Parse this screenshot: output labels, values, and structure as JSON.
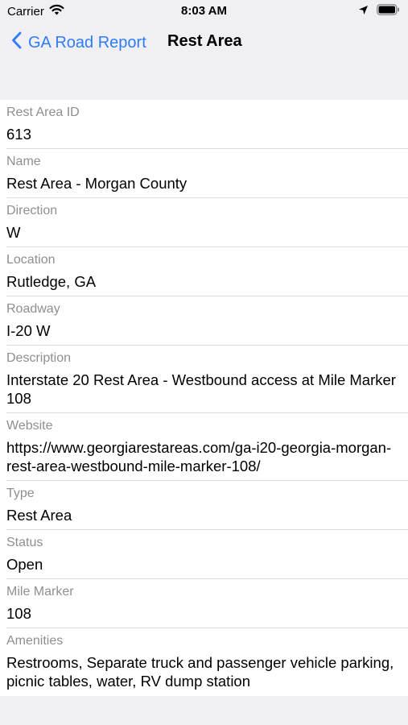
{
  "status_bar": {
    "carrier": "Carrier",
    "time": "8:03 AM"
  },
  "nav": {
    "back_label": "GA Road Report",
    "title": "Rest Area"
  },
  "fields": [
    {
      "label": "Rest Area ID",
      "value": "613"
    },
    {
      "label": "Name",
      "value": "Rest Area - Morgan County"
    },
    {
      "label": "Direction",
      "value": "W"
    },
    {
      "label": "Location",
      "value": "Rutledge, GA"
    },
    {
      "label": "Roadway",
      "value": "I-20 W"
    },
    {
      "label": "Description",
      "value": "Interstate 20 Rest Area - Westbound access at Mile Marker 108"
    },
    {
      "label": "Website",
      "value": "https://www.georgiarestareas.com/ga-i20-georgia-morgan-rest-area-westbound-mile-marker-108/"
    },
    {
      "label": "Type",
      "value": "Rest Area"
    },
    {
      "label": "Status",
      "value": "Open"
    },
    {
      "label": "Mile Marker",
      "value": "108"
    },
    {
      "label": "Amenities",
      "value": "Restrooms, Separate truck and passenger vehicle parking, picnic tables, water, RV dump station"
    }
  ],
  "colors": {
    "accent": "#2f7cf6",
    "background": "#efeff4",
    "secondary_text": "#8e8e93"
  },
  "icons": [
    "wifi-icon",
    "location-arrow-icon",
    "battery-icon",
    "chevron-left-icon"
  ]
}
